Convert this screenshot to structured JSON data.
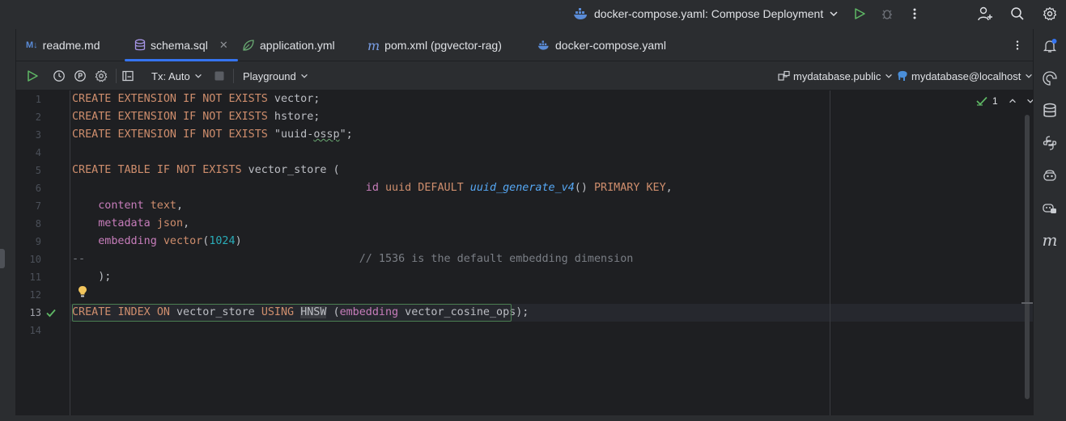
{
  "titlebar": {
    "run_config": "docker-compose.yaml: Compose Deployment"
  },
  "tabs": [
    {
      "label": "readme.md",
      "icon": "markdown-icon",
      "active": false
    },
    {
      "label": "schema.sql",
      "icon": "database-icon",
      "active": true
    },
    {
      "label": "application.yml",
      "icon": "spring-leaf-icon",
      "active": false
    },
    {
      "label": "pom.xml (pgvector-rag)",
      "icon": "maven-icon",
      "active": false
    },
    {
      "label": "docker-compose.yaml",
      "icon": "docker-icon",
      "active": false
    }
  ],
  "toolbar": {
    "tx_mode": "Tx: Auto",
    "playground": "Playground",
    "schema": "mydatabase.public",
    "datasource": "mydatabase@localhost"
  },
  "inspection": {
    "count": "1"
  },
  "editor": {
    "current_line": 13,
    "line_numbers": [
      "1",
      "2",
      "3",
      "4",
      "5",
      "6",
      "7",
      "8",
      "9",
      "10",
      "11",
      "12",
      "13",
      "14"
    ]
  },
  "colors": {
    "accent": "#3574f0",
    "keyword": "#cf8e6d",
    "function": "#56a8f5",
    "number": "#2aacb8",
    "column": "#c77dbb",
    "comment": "#7a7e85",
    "success": "#5fb865"
  }
}
